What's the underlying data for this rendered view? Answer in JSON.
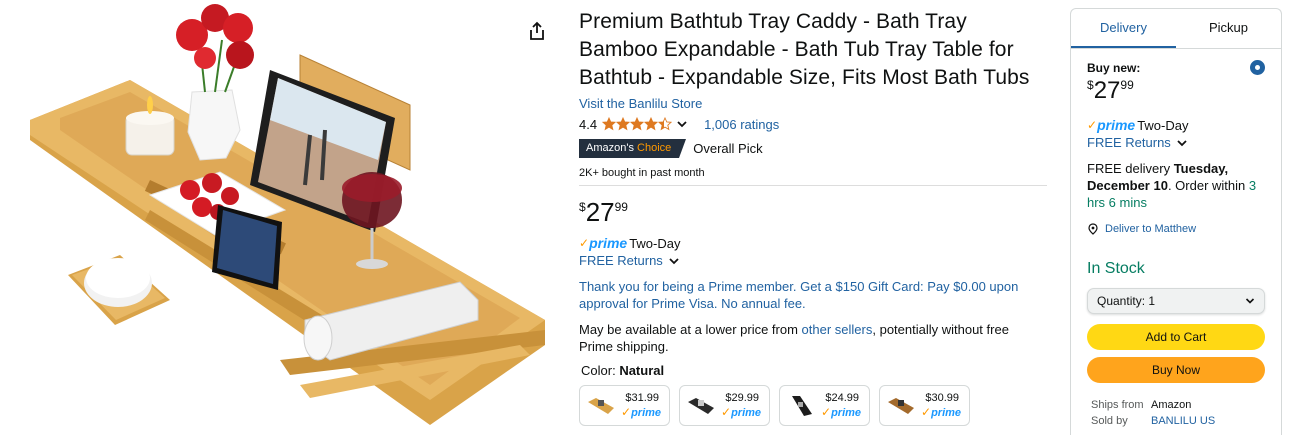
{
  "product": {
    "title": "Premium Bathtub Tray Caddy - Bath Tray Bamboo Expandable - Bath Tub Tray Table for Bathtub - Expandable Size, Fits Most Bath Tubs",
    "store_link": "Visit the Banlilu Store",
    "rating_value": "4.4",
    "rating_stars": 4.4,
    "ratings_count": "1,006 ratings",
    "badge_prefix": "Amazon's",
    "badge_choice": "Choice",
    "badge_label": "Overall Pick",
    "bought": "2K+ bought in past month",
    "price_symbol": "$",
    "price_whole": "27",
    "price_fraction": "99",
    "prime_logo": "prime",
    "prime_label": "Two-Day",
    "free_returns": "FREE Returns",
    "promo": "Thank you for being a Prime member. Get a $150 Gift Card: Pay $0.00 upon approval for Prime Visa. No annual fee.",
    "lower_price_prefix": "May be available at a lower price from ",
    "lower_price_link": "other sellers",
    "lower_price_suffix": ", potentially without free Prime shipping.",
    "color_label": "Color:",
    "color_value": "Natural",
    "swatches": [
      {
        "price": "$31.99",
        "prime": "prime"
      },
      {
        "price": "$29.99",
        "prime": "prime"
      },
      {
        "price": "$24.99",
        "prime": "prime"
      },
      {
        "price": "$30.99",
        "prime": "prime"
      }
    ]
  },
  "buybox": {
    "tabs": [
      "Delivery",
      "Pickup"
    ],
    "buy_new": "Buy new:",
    "price_symbol": "$",
    "price_whole": "27",
    "price_fraction": "99",
    "prime_logo": "prime",
    "prime_label": "Two-Day",
    "free_returns": "FREE Returns",
    "delivery_prefix": "FREE delivery ",
    "delivery_date": "Tuesday, December 10",
    "delivery_mid": ". Order within ",
    "delivery_countdown": "3 hrs 6 mins",
    "deliver_to": "Deliver to Matthew",
    "in_stock": "In Stock",
    "quantity": "Quantity:  1",
    "add_to_cart": "Add to Cart",
    "buy_now": "Buy Now",
    "ships_from_label": "Ships from",
    "ships_from_value": "Amazon",
    "sold_by_label": "Sold by",
    "sold_by_value": "BANLILU US"
  },
  "colors": {
    "link": "#2162a1",
    "prime_blue": "#1a98ff",
    "in_stock_green": "#067d62",
    "add_to_cart": "#ffd814",
    "buy_now": "#ffa41c",
    "star": "#de7921",
    "badge_bg": "#232f3e",
    "badge_accent": "#ff9900"
  },
  "icons": [
    "share-icon",
    "star-icon",
    "chevron-down-icon",
    "radio-selected-icon",
    "location-pin-icon"
  ]
}
